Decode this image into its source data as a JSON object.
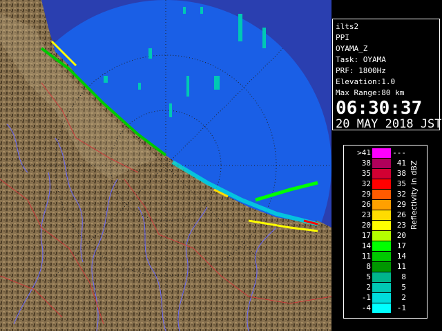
{
  "info": {
    "product": "ilts2",
    "mode": "PPI",
    "variable": "OYAMA_Z",
    "task": "Task: OYAMA",
    "prf": "PRF: 1800Hz",
    "elevation": "Elevation:1.0",
    "max_range": "Max Range:80 km",
    "time": "06:30:37",
    "date": "20 MAY 2018 JST"
  },
  "legend": {
    "unit_label": "Reflectivity in dBZ",
    "rows": [
      {
        "low": ">41",
        "high": "---",
        "color": "#ff00ff"
      },
      {
        "low": "38",
        "high": "41",
        "color": "#b0005a"
      },
      {
        "low": "35",
        "high": "38",
        "color": "#d20032"
      },
      {
        "low": "32",
        "high": "35",
        "color": "#ff0000"
      },
      {
        "low": "29",
        "high": "32",
        "color": "#ff5a00"
      },
      {
        "low": "26",
        "high": "29",
        "color": "#ffa000"
      },
      {
        "low": "23",
        "high": "26",
        "color": "#ffdc00"
      },
      {
        "low": "20",
        "high": "23",
        "color": "#ffff00"
      },
      {
        "low": "17",
        "high": "20",
        "color": "#b4ff00"
      },
      {
        "low": "14",
        "high": "17",
        "color": "#00ff00"
      },
      {
        "low": "11",
        "high": "14",
        "color": "#00c800"
      },
      {
        "low": "8",
        "high": "11",
        "color": "#009600"
      },
      {
        "low": "5",
        "high": "8",
        "color": "#00b48c"
      },
      {
        "low": "2",
        "high": "5",
        "color": "#00c8b4"
      },
      {
        "low": "-1",
        "high": "2",
        "color": "#00dcdc"
      },
      {
        "low": "-4",
        "high": "-1",
        "color": "#00ffff"
      }
    ]
  },
  "colors": {
    "sea_in_range": "#1a5fe6",
    "sea_out_range": "#2a3fb0",
    "land": "#8a7350",
    "rivers": "#6a6aff",
    "boundaries": "#d03a3a",
    "range_rings": "#222222"
  }
}
